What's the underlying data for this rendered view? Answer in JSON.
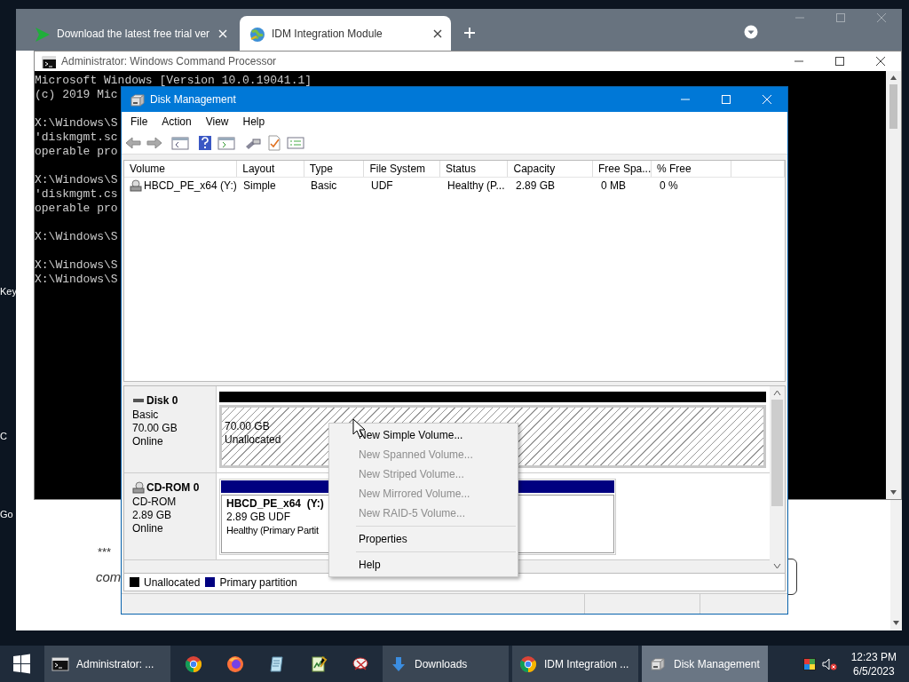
{
  "desktop": {
    "icon_labels": [
      "Key",
      "C",
      "Go"
    ]
  },
  "browser": {
    "tabs": [
      {
        "title": "Download the latest free trial ver",
        "selected": false,
        "kind": "idm"
      },
      {
        "title": "IDM Integration Module",
        "selected": true,
        "kind": "globe"
      }
    ],
    "page_texts": [
      "***",
      "com"
    ]
  },
  "cmd": {
    "title": "Administrator: Windows Command Processor",
    "blocks": [
      [
        "Microsoft Windows [Version 10.0.19041.1]",
        "(c) 2019 Mic"
      ],
      [
        "X:\\Windows\\S",
        "'diskmgmt.sc",
        "operable pro"
      ],
      [
        "X:\\Windows\\S",
        "'diskmgmt.cs",
        "operable pro"
      ],
      [
        "X:\\Windows\\S"
      ],
      [
        "X:\\Windows\\S",
        "X:\\Windows\\S"
      ]
    ]
  },
  "disk_management": {
    "title": "Disk Management",
    "menu": [
      "File",
      "Action",
      "View",
      "Help"
    ],
    "columns": [
      "Volume",
      "Layout",
      "Type",
      "File System",
      "Status",
      "Capacity",
      "Free Spa...",
      "% Free"
    ],
    "rows": [
      [
        "HBCD_PE_x64 (Y:)",
        "Simple",
        "Basic",
        "UDF",
        "Healthy (P...",
        "2.89 GB",
        "0 MB",
        "0 %"
      ]
    ],
    "disks": [
      {
        "kind": "disk",
        "name": "Disk 0",
        "type": "Basic",
        "size": "70.00 GB",
        "status": "Online",
        "partitions": [
          {
            "kind": "unallocated",
            "size": "70.00 GB",
            "detail": "Unallocated"
          }
        ]
      },
      {
        "kind": "cdrom",
        "name": "CD-ROM 0",
        "type": "CD-ROM",
        "size": "2.89 GB",
        "status": "Online",
        "partitions": [
          {
            "kind": "primary",
            "name": "HBCD_PE_x64  (Y:)",
            "size": "2.89 GB UDF",
            "detail": "Healthy (Primary Partit"
          }
        ]
      }
    ],
    "legend": [
      {
        "label": "Unallocated",
        "color": "#000000"
      },
      {
        "label": "Primary partition",
        "color": "#000080"
      }
    ]
  },
  "context_menu": [
    {
      "kind": "item",
      "label": "New Simple Volume...",
      "disabled": false
    },
    {
      "kind": "item",
      "label": "New Spanned Volume...",
      "disabled": true
    },
    {
      "kind": "item",
      "label": "New Striped Volume...",
      "disabled": true
    },
    {
      "kind": "item",
      "label": "New Mirrored Volume...",
      "disabled": true
    },
    {
      "kind": "item",
      "label": "New RAID-5 Volume...",
      "disabled": true
    },
    {
      "kind": "separator"
    },
    {
      "kind": "item",
      "label": "Properties",
      "disabled": false
    },
    {
      "kind": "separator"
    },
    {
      "kind": "item",
      "label": "Help",
      "disabled": false
    }
  ],
  "taskbar": {
    "buttons": [
      {
        "kind": "cmd",
        "label": "Administrator: ...",
        "selected": false
      },
      {
        "kind": "chrome",
        "selected": false
      },
      {
        "kind": "firefox",
        "selected": false
      },
      {
        "kind": "notepad",
        "selected": false
      },
      {
        "kind": "editor",
        "selected": false
      },
      {
        "kind": "snip",
        "selected": false
      },
      {
        "kind": "download",
        "label": "Downloads",
        "selected": false
      },
      {
        "kind": "chrome",
        "label": "IDM Integration ...",
        "selected": false
      },
      {
        "kind": "disk",
        "label": "Disk Management",
        "selected": true
      }
    ],
    "time": "12:23 PM",
    "date": "6/5/2023"
  }
}
